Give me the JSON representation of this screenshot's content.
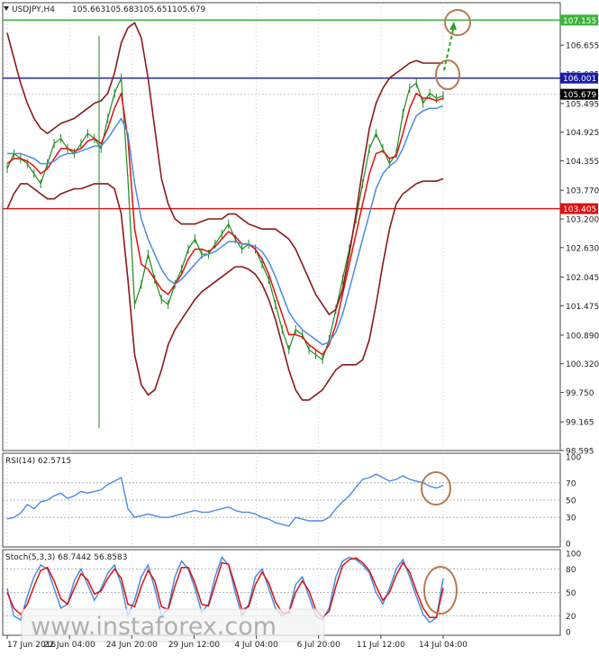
{
  "chart_data": [
    {
      "type": "line",
      "title": "USDJPY,H4",
      "ohlc_header": [
        "105.663",
        "105.683",
        "105.651",
        "105.679"
      ],
      "ylim": [
        98.595,
        107.5
      ],
      "y_ticks": [
        "107.155",
        "106.655",
        "106.085",
        "105.495",
        "104.925",
        "104.355",
        "103.770",
        "103.200",
        "102.630",
        "102.045",
        "101.475",
        "100.890",
        "100.320",
        "99.750",
        "99.165",
        "98.595"
      ],
      "x_ticks": [
        "17 Jun 2016",
        "22 Jun 04:00",
        "24 Jun 20:00",
        "29 Jun 12:00",
        "4 Jul 04:00",
        "6 Jul 20:00",
        "11 Jul 12:00",
        "14 Jul 04:00"
      ],
      "levels": [
        {
          "label": "107.155",
          "value": 107.155,
          "color": "#3cb43c"
        },
        {
          "label": "106.001",
          "value": 106.001,
          "color": "#1a1aa8"
        },
        {
          "label": "103.405",
          "value": 103.405,
          "color": "#e01010"
        }
      ],
      "current_price": {
        "label": "105.679",
        "value": 105.679
      },
      "series": [
        {
          "role": "price",
          "color": "#1e8a1e",
          "values": [
            104.2,
            104.5,
            104.4,
            104.3,
            104.1,
            103.9,
            104.3,
            104.7,
            104.8,
            104.6,
            104.5,
            104.7,
            104.9,
            104.8,
            104.6,
            105.2,
            105.7,
            106.0,
            104.0,
            101.5,
            101.9,
            102.5,
            102.0,
            101.6,
            101.5,
            101.9,
            102.2,
            102.6,
            102.8,
            102.5,
            102.5,
            102.7,
            102.9,
            103.1,
            102.8,
            102.6,
            102.7,
            102.6,
            102.3,
            102.0,
            101.5,
            101.0,
            100.6,
            101.0,
            100.9,
            100.6,
            100.5,
            100.4,
            100.8,
            101.4,
            102.0,
            102.6,
            103.2,
            103.9,
            104.6,
            104.9,
            104.6,
            104.3,
            104.5,
            105.3,
            105.8,
            105.9,
            105.5,
            105.7,
            105.6,
            105.65
          ]
        },
        {
          "role": "ma_fast",
          "color": "#e01010",
          "values": [
            104.3,
            104.4,
            104.4,
            104.35,
            104.25,
            104.1,
            104.2,
            104.4,
            104.6,
            104.6,
            104.55,
            104.6,
            104.75,
            104.8,
            104.7,
            105.0,
            105.4,
            105.7,
            104.8,
            103.0,
            102.3,
            102.2,
            102.0,
            101.8,
            101.7,
            101.9,
            102.1,
            102.4,
            102.6,
            102.6,
            102.55,
            102.65,
            102.8,
            102.95,
            102.85,
            102.7,
            102.7,
            102.6,
            102.4,
            102.1,
            101.7,
            101.3,
            100.9,
            100.9,
            100.85,
            100.7,
            100.6,
            100.5,
            100.7,
            101.1,
            101.7,
            102.3,
            102.9,
            103.5,
            104.1,
            104.5,
            104.55,
            104.4,
            104.45,
            104.9,
            105.4,
            105.7,
            105.6,
            105.6,
            105.55,
            105.6
          ]
        },
        {
          "role": "ma_slow",
          "color": "#4a8ce0",
          "values": [
            104.5,
            104.5,
            104.5,
            104.45,
            104.4,
            104.3,
            104.3,
            104.35,
            104.45,
            104.5,
            104.5,
            104.55,
            104.6,
            104.65,
            104.65,
            104.8,
            105.0,
            105.2,
            104.9,
            103.9,
            103.2,
            102.8,
            102.5,
            102.2,
            102.0,
            101.9,
            102.0,
            102.15,
            102.3,
            102.45,
            102.5,
            102.55,
            102.65,
            102.75,
            102.75,
            102.7,
            102.7,
            102.65,
            102.55,
            102.35,
            102.05,
            101.7,
            101.35,
            101.15,
            101.0,
            100.9,
            100.8,
            100.7,
            100.75,
            100.95,
            101.3,
            101.8,
            102.3,
            102.8,
            103.3,
            103.8,
            104.1,
            104.25,
            104.35,
            104.6,
            104.95,
            105.25,
            105.35,
            105.4,
            105.4,
            105.45
          ]
        },
        {
          "role": "bb_upper",
          "color": "#8b1a1a",
          "values": [
            106.9,
            106.4,
            105.9,
            105.5,
            105.2,
            105.0,
            104.9,
            105.0,
            105.1,
            105.15,
            105.2,
            105.3,
            105.4,
            105.5,
            105.55,
            105.7,
            106.1,
            106.7,
            107.0,
            107.1,
            106.8,
            106.0,
            105.0,
            104.0,
            103.5,
            103.2,
            103.1,
            103.1,
            103.1,
            103.15,
            103.2,
            103.2,
            103.2,
            103.3,
            103.3,
            103.2,
            103.1,
            103.05,
            103.0,
            103.0,
            103.0,
            102.9,
            102.8,
            102.6,
            102.3,
            102.0,
            101.7,
            101.5,
            101.3,
            101.4,
            101.8,
            102.5,
            103.3,
            104.2,
            105.0,
            105.5,
            105.8,
            106.0,
            106.1,
            106.2,
            106.3,
            106.35,
            106.3,
            106.3,
            106.3,
            106.3
          ]
        },
        {
          "role": "bb_lower",
          "color": "#8b1a1a",
          "values": [
            103.4,
            103.7,
            103.9,
            103.9,
            103.8,
            103.7,
            103.6,
            103.6,
            103.7,
            103.75,
            103.8,
            103.8,
            103.85,
            103.9,
            103.9,
            103.9,
            103.8,
            103.3,
            102.0,
            100.5,
            99.9,
            99.7,
            99.8,
            100.2,
            100.7,
            101.0,
            101.2,
            101.4,
            101.6,
            101.75,
            101.85,
            101.95,
            102.05,
            102.15,
            102.25,
            102.25,
            102.2,
            102.1,
            101.9,
            101.6,
            101.2,
            100.7,
            100.2,
            99.8,
            99.6,
            99.6,
            99.7,
            99.8,
            100.0,
            100.2,
            100.3,
            100.3,
            100.3,
            100.4,
            100.8,
            101.5,
            102.3,
            103.0,
            103.5,
            103.7,
            103.8,
            103.9,
            103.95,
            103.95,
            103.95,
            104.0
          ]
        }
      ]
    },
    {
      "type": "line",
      "title": "RSI(14) 62.5715",
      "ylim": [
        0,
        100
      ],
      "y_ticks": [
        "100",
        "70",
        "50",
        "30",
        "0"
      ],
      "levels": [
        70,
        50,
        30
      ],
      "series": [
        {
          "color": "#4a8ce0",
          "values": [
            28,
            30,
            35,
            45,
            40,
            48,
            50,
            55,
            58,
            52,
            55,
            60,
            58,
            60,
            62,
            68,
            72,
            76,
            40,
            30,
            32,
            34,
            32,
            30,
            30,
            32,
            34,
            36,
            38,
            36,
            36,
            38,
            40,
            42,
            38,
            36,
            36,
            34,
            30,
            28,
            24,
            22,
            20,
            30,
            28,
            26,
            26,
            26,
            30,
            40,
            48,
            55,
            65,
            74,
            76,
            80,
            76,
            72,
            74,
            78,
            74,
            72,
            70,
            66,
            64,
            67
          ]
        }
      ]
    },
    {
      "type": "line",
      "title": "Stoch(5,3,3) 68.7442 56.8583",
      "ylim": [
        0,
        100
      ],
      "y_ticks": [
        "100",
        "80",
        "50",
        "20",
        "0"
      ],
      "levels": [
        80,
        50,
        20
      ],
      "series": [
        {
          "color": "#4a8ce0",
          "values": [
            55,
            20,
            15,
            45,
            70,
            85,
            80,
            55,
            30,
            35,
            65,
            80,
            60,
            40,
            55,
            75,
            85,
            60,
            20,
            40,
            70,
            85,
            55,
            20,
            30,
            70,
            90,
            80,
            55,
            25,
            35,
            70,
            95,
            85,
            50,
            20,
            35,
            70,
            80,
            55,
            30,
            20,
            25,
            60,
            70,
            45,
            20,
            15,
            30,
            70,
            90,
            95,
            92,
            85,
            75,
            50,
            35,
            55,
            80,
            92,
            70,
            45,
            22,
            12,
            18,
            68
          ]
        },
        {
          "color": "#e01010",
          "values": [
            50,
            30,
            22,
            35,
            58,
            78,
            82,
            65,
            42,
            35,
            55,
            74,
            66,
            48,
            52,
            68,
            80,
            68,
            35,
            32,
            58,
            78,
            65,
            32,
            28,
            58,
            82,
            82,
            62,
            35,
            33,
            60,
            88,
            86,
            58,
            28,
            32,
            60,
            76,
            62,
            38,
            24,
            24,
            50,
            65,
            52,
            28,
            18,
            26,
            58,
            84,
            92,
            94,
            88,
            78,
            58,
            40,
            50,
            72,
            88,
            76,
            52,
            30,
            18,
            18,
            56
          ]
        }
      ]
    }
  ],
  "watermark": "www.instaforex.com"
}
